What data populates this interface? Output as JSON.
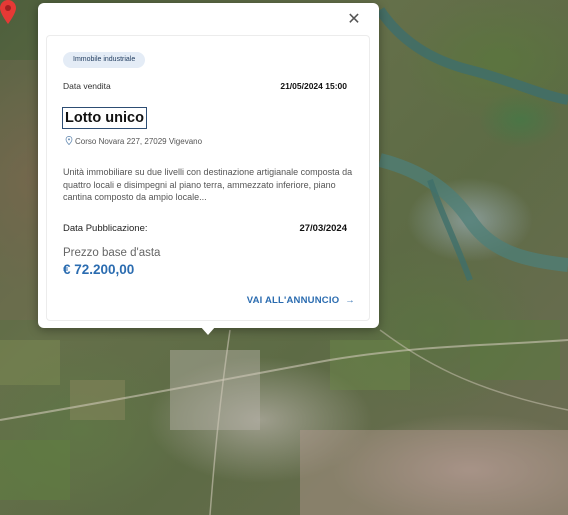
{
  "popup": {
    "close_icon": "close-icon",
    "badge": "Immobile industriale",
    "sale_label": "Data vendita",
    "sale_date": "21/05/2024 15:00",
    "title": "Lotto unico",
    "address_icon": "location-pin-icon",
    "address": "Corso Novara 227, 27029 Vigevano",
    "description": "Unità immobiliare su due livelli con destinazione artigianale composta da quattro locali e disimpegni al piano terra, ammezzato inferiore, piano cantina composto da ampio locale...",
    "publication_label": "Data Pubblicazione:",
    "publication_date": "27/03/2024",
    "price_label": "Prezzo base d'asta",
    "price_value": "€ 72.200,00",
    "cta_label": "VAI ALL'ANNUNCIO",
    "cta_icon": "arrow-right-icon"
  },
  "map": {
    "type": "satellite",
    "marker_icon": "map-marker-icon",
    "marker_color": "#e53935"
  },
  "colors": {
    "accent": "#2b6cb0",
    "badge_bg": "#e4ecf6"
  }
}
